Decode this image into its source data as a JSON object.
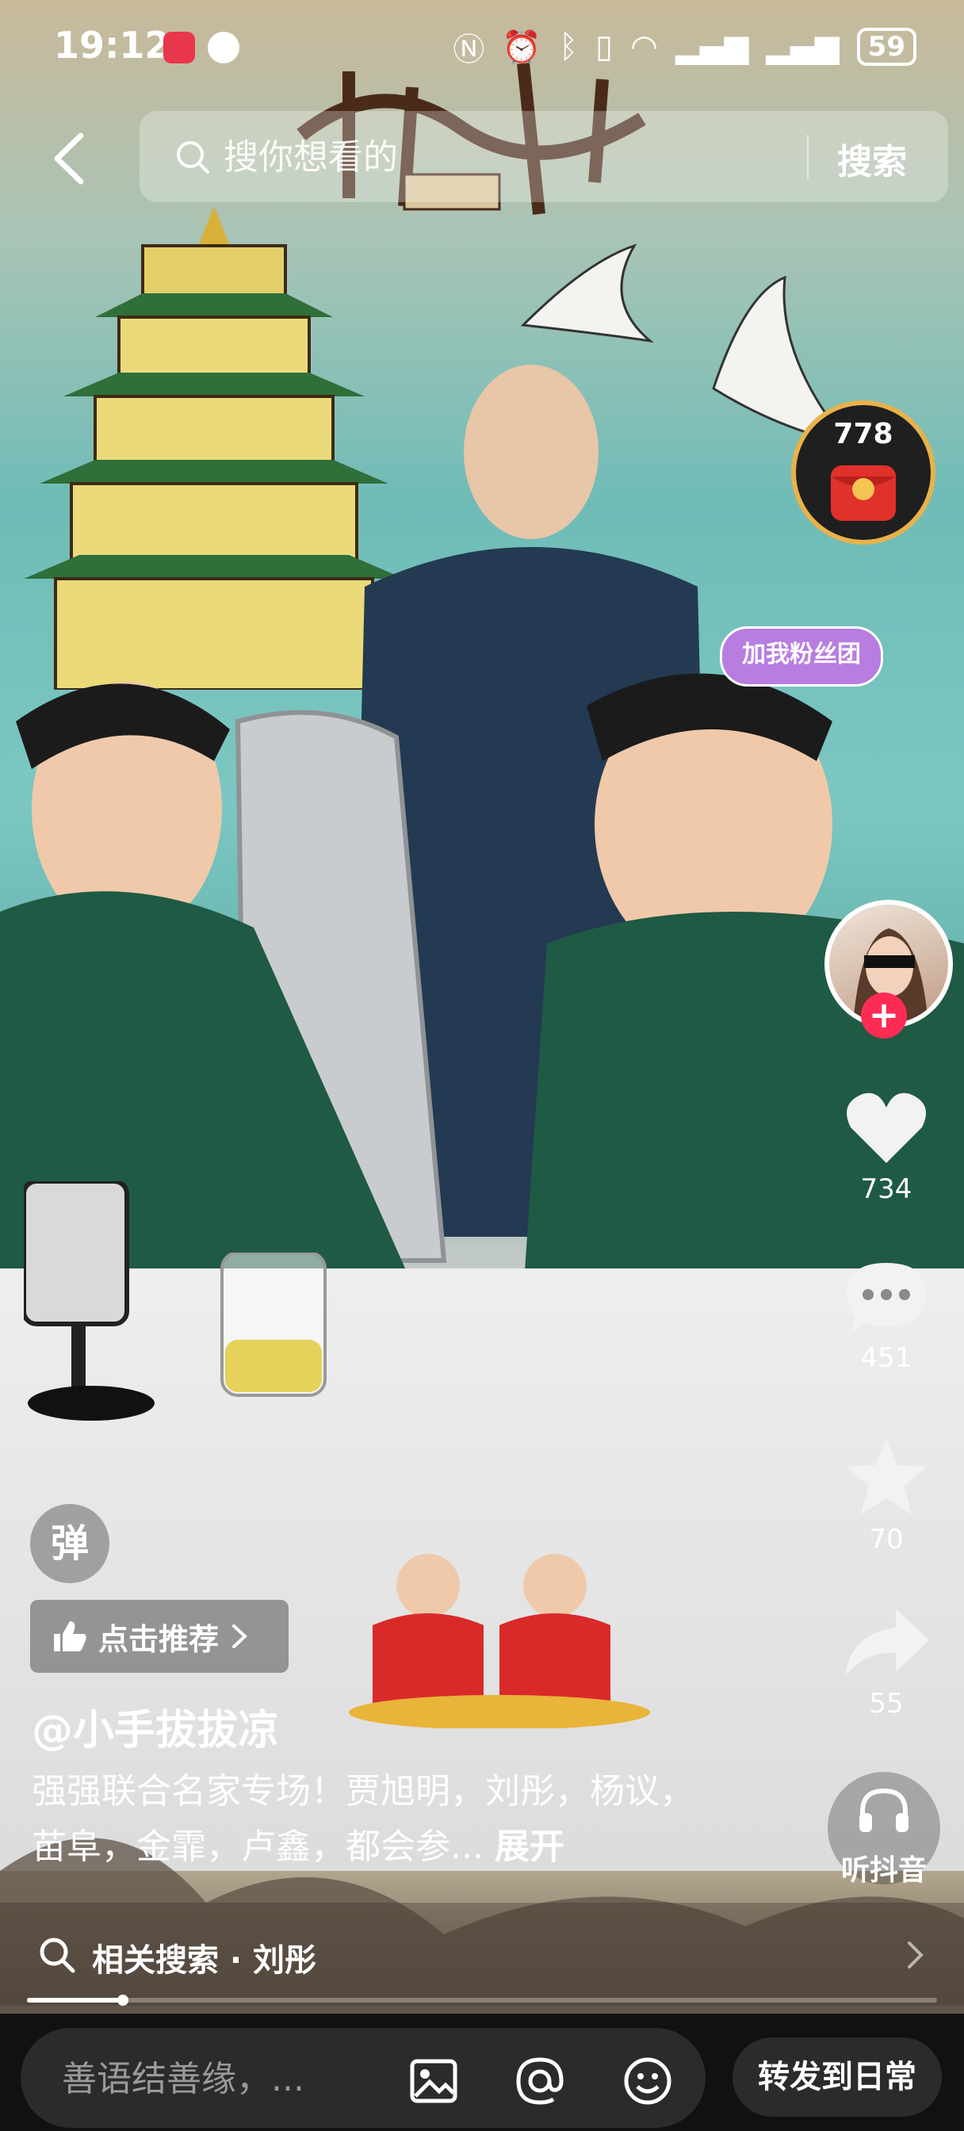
{
  "status_bar": {
    "time": "19:12",
    "battery": "59"
  },
  "search": {
    "placeholder": "搜你想看的",
    "button_label": "搜索"
  },
  "live": {
    "count": "778"
  },
  "fan_badge": {
    "label": "加我粉丝团"
  },
  "actions": {
    "likes": "734",
    "comments": "451",
    "favorites": "70",
    "shares": "55"
  },
  "overlay": {
    "danmu_label": "弹",
    "recommend_label": "点击推荐",
    "author": "@小手拔拔凉",
    "caption": "强强联合名家专场！贾旭明，刘彤，杨议，苗阜，金霏，卢鑫，都会参...",
    "expand_label": "展开",
    "listen_label": "听抖音"
  },
  "related": {
    "label": "相关搜索 · 刘彤"
  },
  "progress": {
    "fraction": 0.105
  },
  "bottom": {
    "comment_placeholder": "善语结善缘，...",
    "share_label": "转发到日常"
  },
  "colors": {
    "accent": "#fe2c55",
    "bottom_bg": "#111111",
    "badge_ring": "#e9b24a"
  }
}
